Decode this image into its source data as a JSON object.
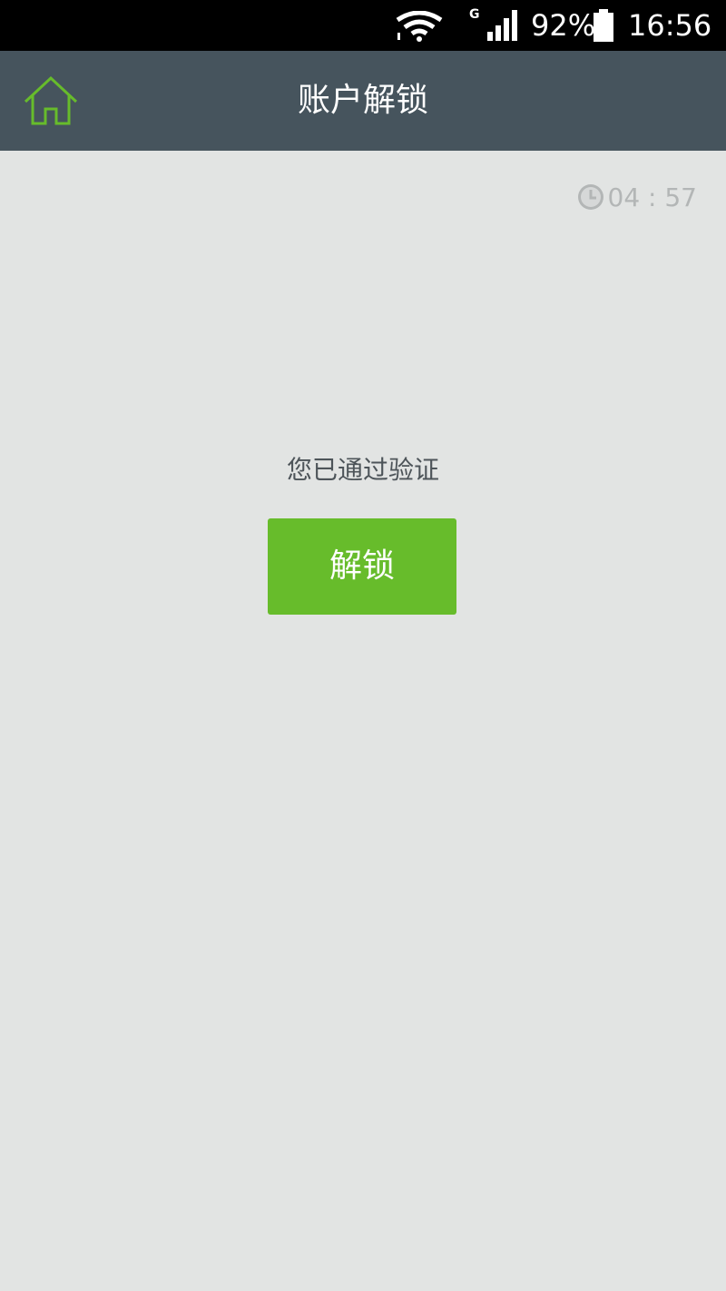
{
  "status_bar": {
    "network_type": "G",
    "battery_percent": "92%",
    "time": "16:56",
    "icons": [
      "wifi-icon",
      "signal-icon",
      "battery-icon"
    ]
  },
  "app_bar": {
    "title": "账户解锁",
    "home_icon": "home-icon"
  },
  "timer": {
    "icon": "clock-icon",
    "value": "04 : 57"
  },
  "main": {
    "message": "您已通过验证",
    "unlock_label": "解锁"
  },
  "colors": {
    "app_bar": "#46545d",
    "background": "#e2e4e3",
    "accent_green": "#67bc2b",
    "timer_text": "#b3b6b6",
    "message_text": "#4d5459"
  }
}
